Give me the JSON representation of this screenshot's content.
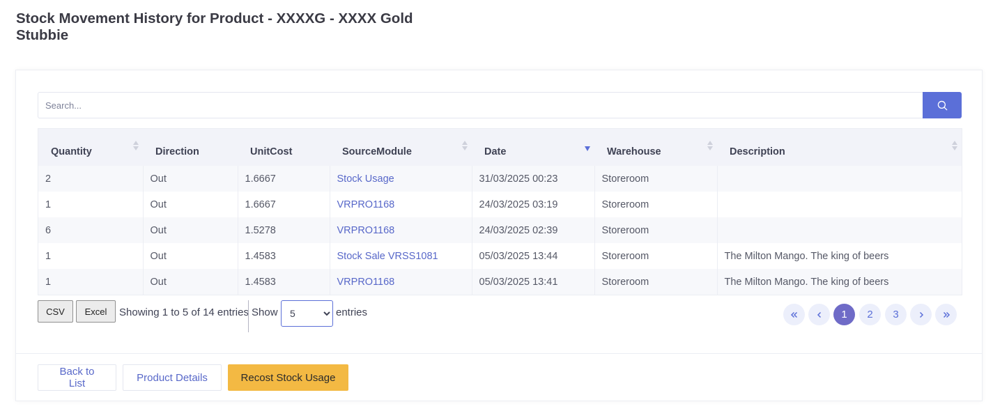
{
  "page": {
    "title": "Stock Movement History for Product - XXXXG - XXXX Gold Stubbie"
  },
  "search": {
    "placeholder": "Search...",
    "value": "",
    "button_icon": "search-icon"
  },
  "table": {
    "columns": [
      "Quantity",
      "Direction",
      "UnitCost",
      "SourceModule",
      "Date",
      "Warehouse",
      "Description"
    ],
    "sort": {
      "column": "Date",
      "direction": "descending"
    },
    "rows": [
      {
        "quantity": "2",
        "direction": "Out",
        "unit_cost": "1.6667",
        "source_module": "Stock Usage",
        "date": "31/03/2025 00:23",
        "warehouse": "Storeroom",
        "description": ""
      },
      {
        "quantity": "1",
        "direction": "Out",
        "unit_cost": "1.6667",
        "source_module": "VRPRO1168",
        "date": "24/03/2025 03:19",
        "warehouse": "Storeroom",
        "description": ""
      },
      {
        "quantity": "6",
        "direction": "Out",
        "unit_cost": "1.5278",
        "source_module": "VRPRO1168",
        "date": "24/03/2025 02:39",
        "warehouse": "Storeroom",
        "description": ""
      },
      {
        "quantity": "1",
        "direction": "Out",
        "unit_cost": "1.4583",
        "source_module": "Stock Sale VRSS1081",
        "date": "05/03/2025 13:44",
        "warehouse": "Storeroom",
        "description": "The Milton Mango. The king of beers"
      },
      {
        "quantity": "1",
        "direction": "Out",
        "unit_cost": "1.4583",
        "source_module": "VRPRO1168",
        "date": "05/03/2025 13:41",
        "warehouse": "Storeroom",
        "description": "The Milton Mango. The king of beers"
      }
    ]
  },
  "export": {
    "csv_label": "CSV",
    "excel_label": "Excel"
  },
  "info": {
    "text": "Showing 1 to 5 of 14 entries",
    "show_label": "Show",
    "entries_label": "entries",
    "page_length": "5",
    "page_length_options": [
      "5"
    ]
  },
  "pagination": {
    "first_icon": "double-chevron-left-icon",
    "prev_icon": "chevron-left-icon",
    "pages": [
      "1",
      "2",
      "3"
    ],
    "current": "1",
    "next_icon": "chevron-right-icon",
    "last_icon": "double-chevron-right-icon"
  },
  "actions": {
    "back_label": "Back to List",
    "details_label": "Product Details",
    "recost_label": "Recost Stock Usage"
  },
  "colors": {
    "accent": "#5b6fd8",
    "active_page": "#6f6bc7",
    "recost_button": "#f3b943",
    "link": "#5868c9"
  }
}
